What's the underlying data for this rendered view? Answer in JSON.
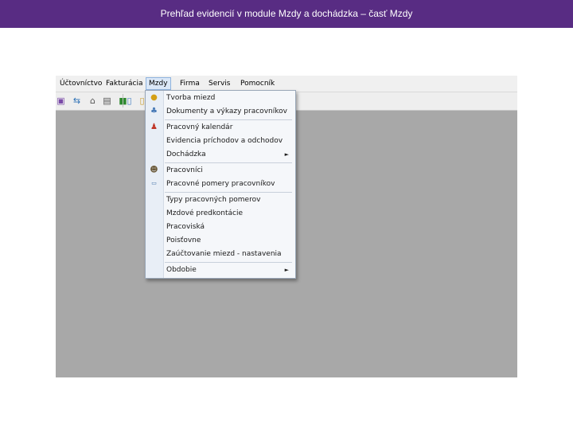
{
  "slide": {
    "title": "Prehľad evidencií v module Mzdy a dochádzka – časť Mzdy"
  },
  "menubar": {
    "items": [
      {
        "label": "Účtovníctvo"
      },
      {
        "label": "Fakturácia"
      },
      {
        "label": "Mzdy"
      },
      {
        "label": "Firma"
      },
      {
        "label": "Servis"
      },
      {
        "label": "Pomocník"
      }
    ]
  },
  "mzdy_menu": {
    "items": [
      {
        "label": "Tvorba miezd",
        "icon": "payroll-coin-icon"
      },
      {
        "label": "Dokumenty a výkazy pracovníkov",
        "icon": "documents-people-icon"
      },
      {
        "label": "Pracovný kalendár",
        "icon": "calendar-person-icon"
      },
      {
        "label": "Evidencia príchodov a odchodov"
      },
      {
        "label": "Dochádzka",
        "submenu": true
      },
      {
        "label": "Pracovníci",
        "icon": "worker-icon"
      },
      {
        "label": "Pracovné pomery pracovníkov",
        "icon": "contract-icon"
      },
      {
        "label": "Typy pracovných pomerov"
      },
      {
        "label": "Mzdové predkontácie"
      },
      {
        "label": "Pracoviská"
      },
      {
        "label": "Poisťovne"
      },
      {
        "label": "Zaúčtovanie miezd - nastavenia"
      },
      {
        "label": "Obdobie",
        "submenu": true
      }
    ],
    "submenu_arrow": "►"
  },
  "colors": {
    "header_bg": "#582c83",
    "workspace_bg": "#a8a8a8",
    "menu_highlight": "#dbe8f8"
  }
}
